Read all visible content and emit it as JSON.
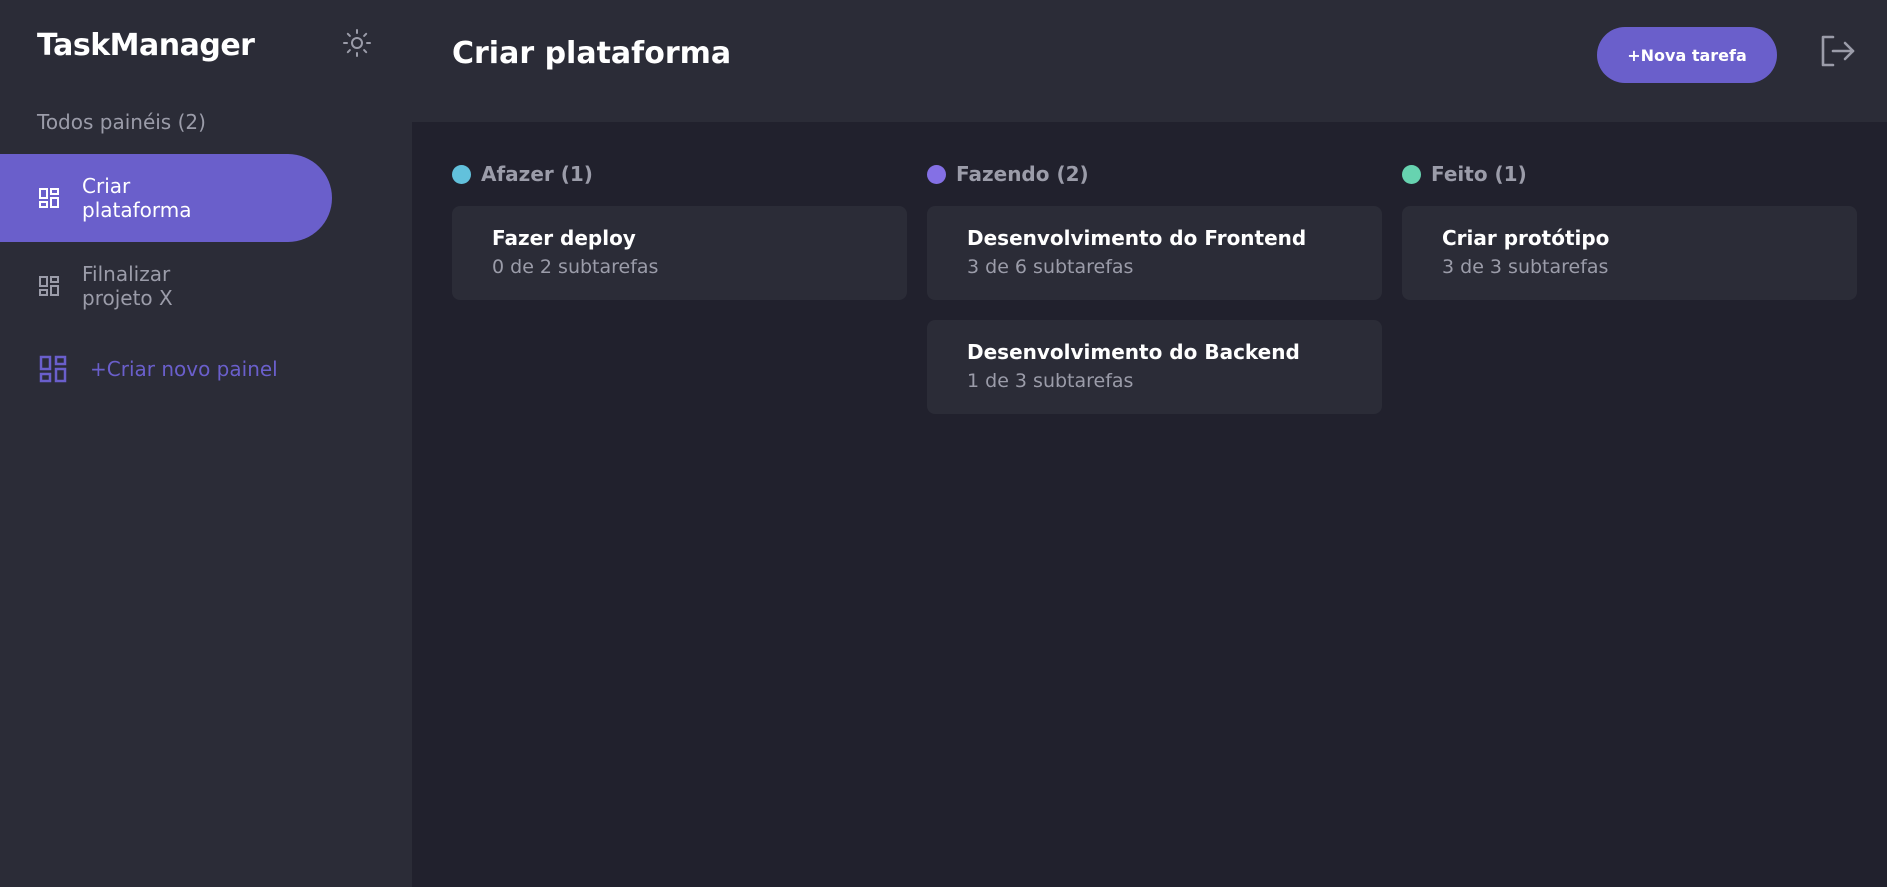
{
  "app": {
    "logo": "TaskManager",
    "accent_color": "#6a5fcb",
    "theme_icon": "sun-icon"
  },
  "sidebar": {
    "boards_heading": "Todos painéis (2)",
    "boards": [
      {
        "label": "Criar plataforma",
        "active": true,
        "icon": "board-icon"
      },
      {
        "label": "Filnalizar projeto X",
        "active": false,
        "icon": "board-icon"
      }
    ],
    "create_label": "+Criar novo painel"
  },
  "header": {
    "title": "Criar plataforma",
    "new_task_label": "+Nova tarefa",
    "logout_icon": "logout-icon"
  },
  "columns": [
    {
      "title": "Afazer (1)",
      "color": "#62c1dc",
      "tasks": [
        {
          "title": "Fazer deploy",
          "subtasks": "0 de 2 subtarefas"
        }
      ]
    },
    {
      "title": "Fazendo (2)",
      "color": "#8470e5",
      "tasks": [
        {
          "title": "Desenvolvimento do Frontend",
          "subtasks": "3 de 6 subtarefas"
        },
        {
          "title": "Desenvolvimento do Backend",
          "subtasks": "1 de 3 subtarefas"
        }
      ]
    },
    {
      "title": "Feito (1)",
      "color": "#67d3b0",
      "tasks": [
        {
          "title": "Criar protótipo",
          "subtasks": "3 de 3 subtarefas"
        }
      ]
    }
  ]
}
